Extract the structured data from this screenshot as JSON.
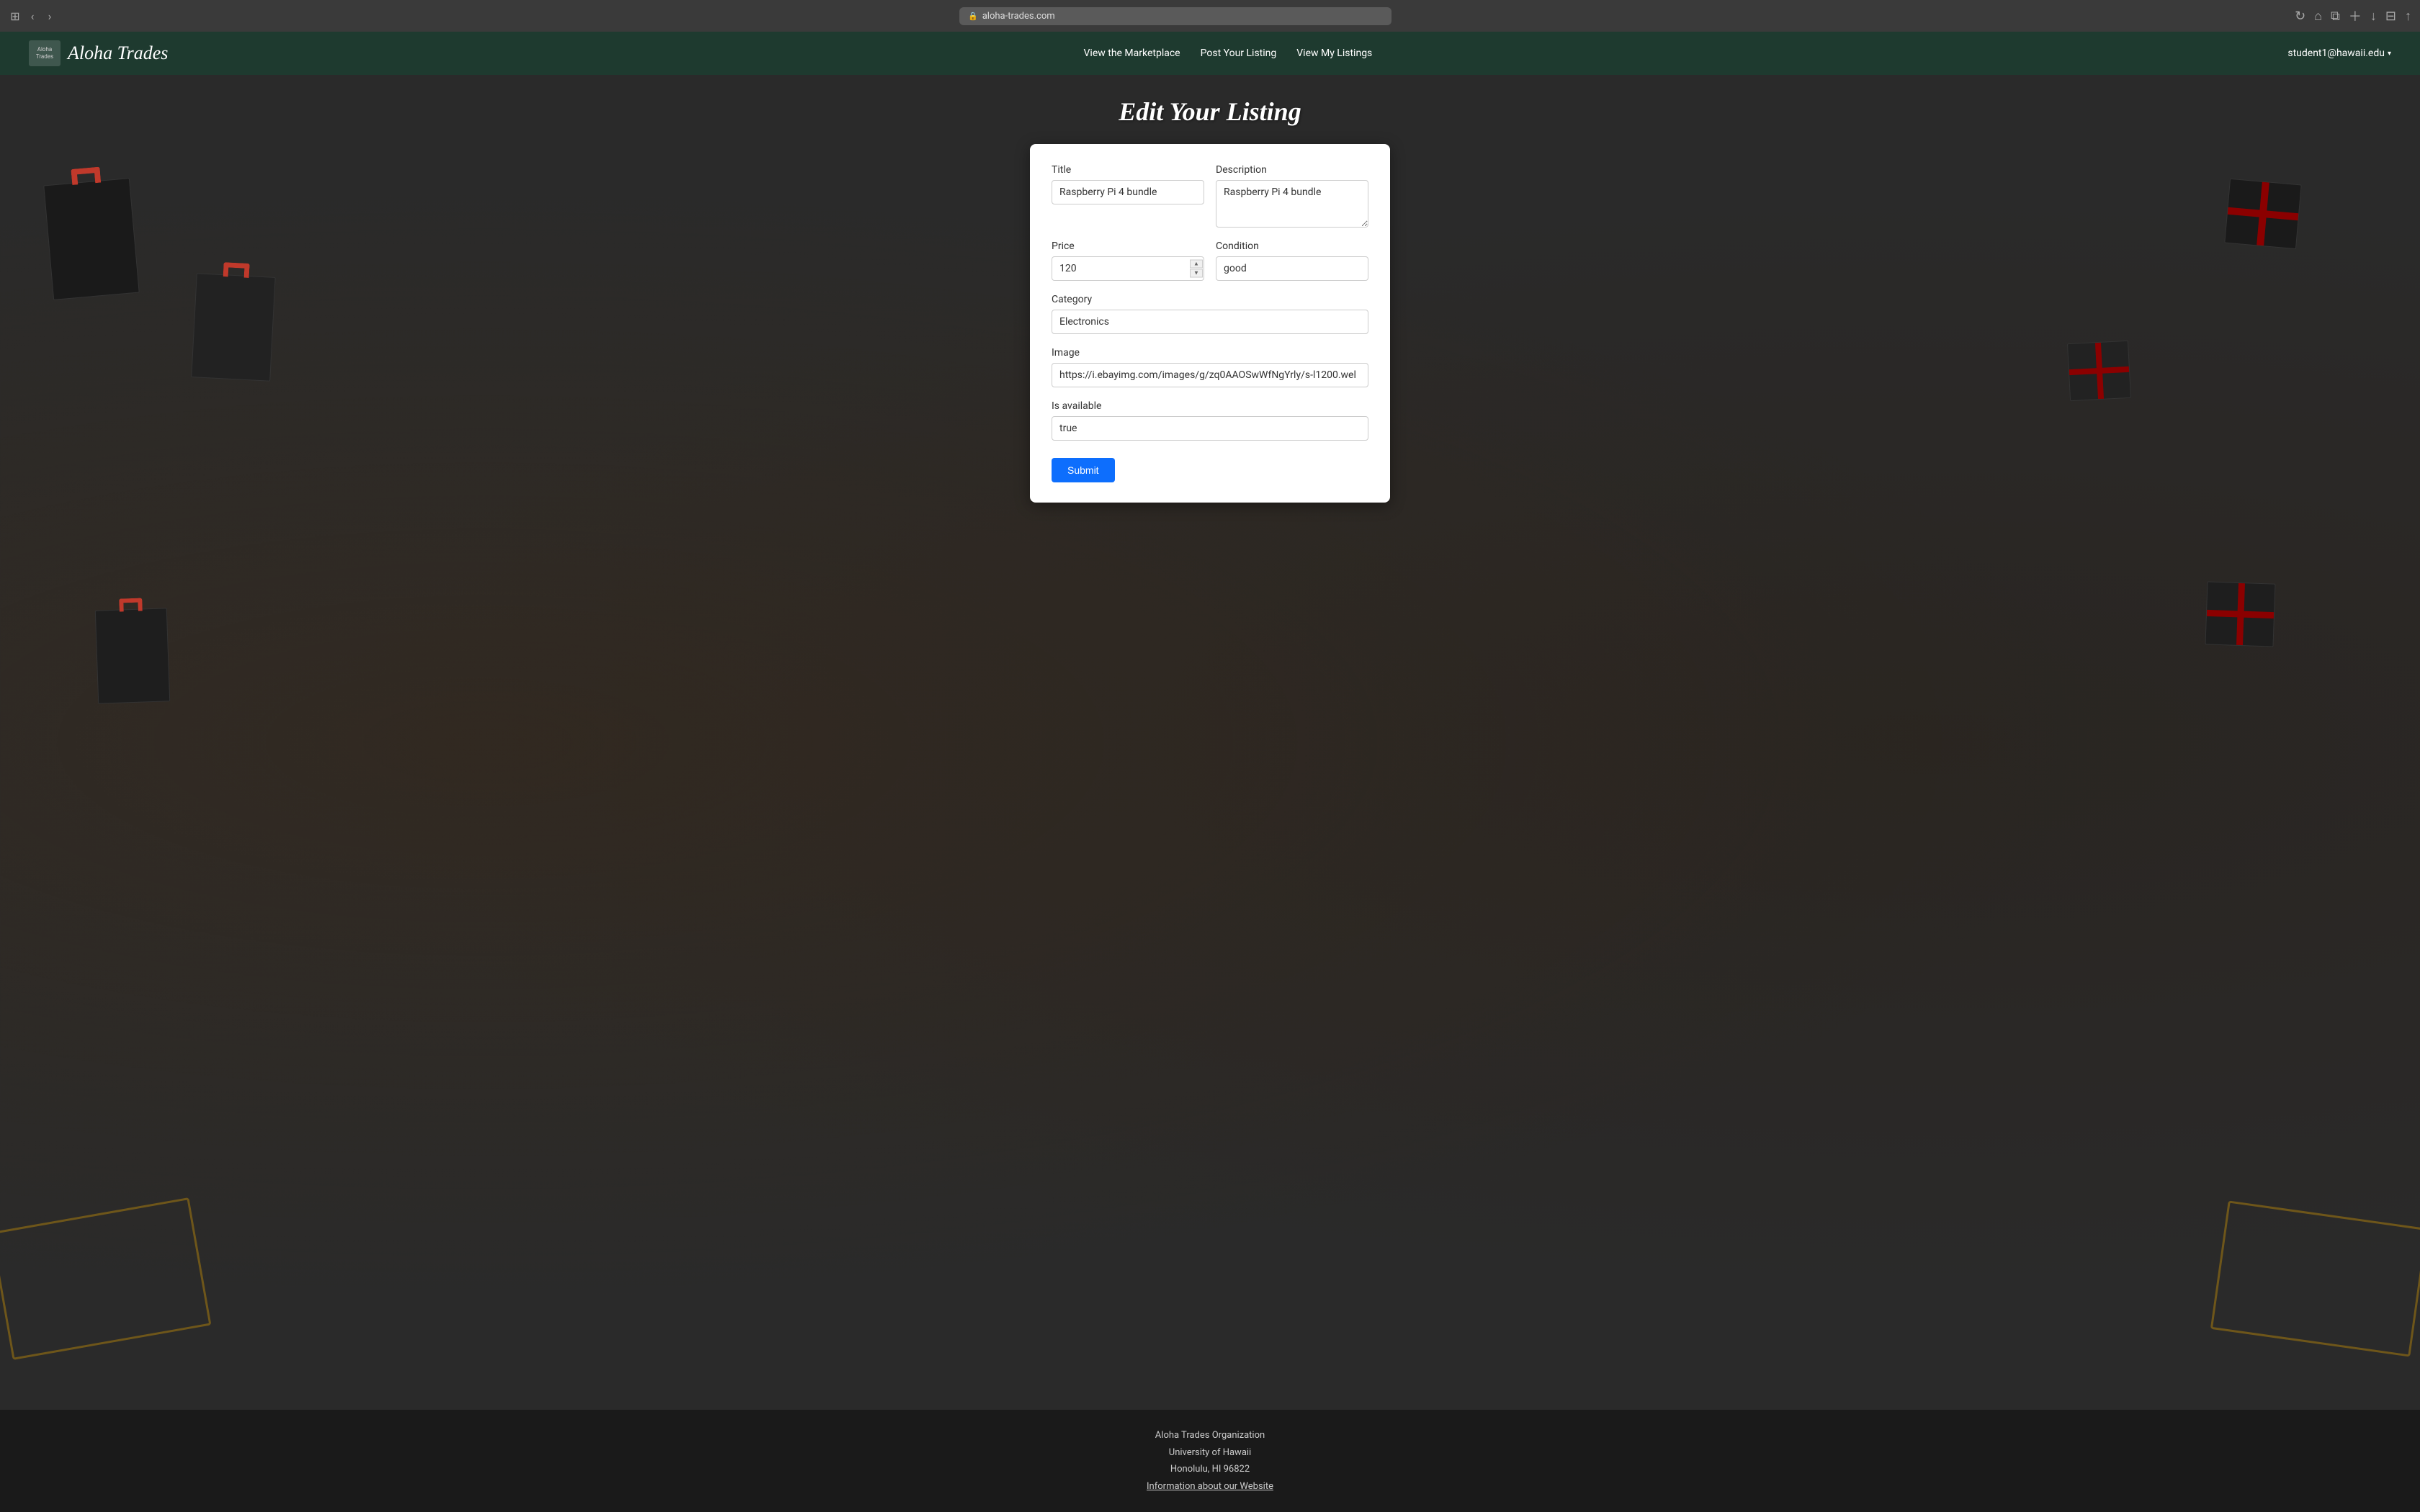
{
  "browser": {
    "url": "aloha-trades.com",
    "lock_symbol": "🔒"
  },
  "navbar": {
    "brand": "Aloha Trades",
    "logo_text": "Aloha Trades",
    "links": [
      {
        "label": "View the Marketplace",
        "id": "view-marketplace"
      },
      {
        "label": "Post Your Listing",
        "id": "post-listing"
      },
      {
        "label": "View My Listings",
        "id": "view-my-listings"
      }
    ],
    "user": "student1@hawaii.edu"
  },
  "page": {
    "title": "Edit Your Listing"
  },
  "form": {
    "title_label": "Title",
    "title_value": "Raspberry Pi 4 bundle",
    "description_label": "Description",
    "description_value": "Raspberry Pi 4 bundle",
    "price_label": "Price",
    "price_value": "120",
    "condition_label": "Condition",
    "condition_value": "good",
    "category_label": "Category",
    "category_value": "Electronics",
    "image_label": "Image",
    "image_value": "https://i.ebayimg.com/images/g/zq0AAOSwWfNgYrly/s-l1200.wel",
    "is_available_label": "Is available",
    "is_available_value": "true",
    "submit_label": "Submit"
  },
  "footer": {
    "line1": "Aloha Trades Organization",
    "line2": "University of Hawaii",
    "line3": "Honolulu, HI 96822",
    "info_link": "Information about our Website"
  }
}
